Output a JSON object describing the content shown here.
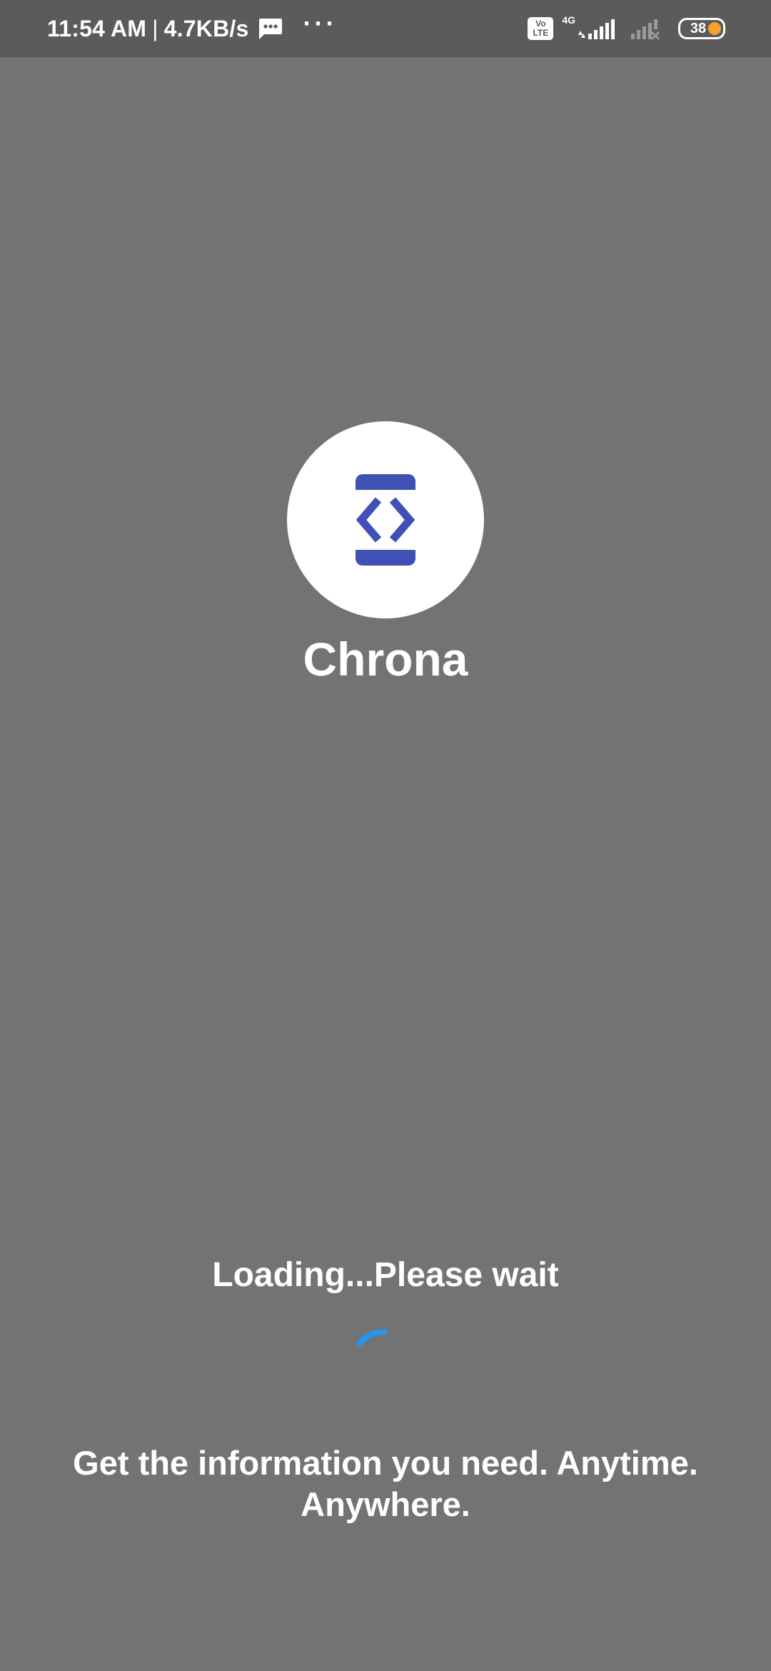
{
  "status_bar": {
    "time": "11:54 AM",
    "separator": "|",
    "net_speed": "4.7KB/s",
    "more_indicator": "···",
    "volte_label_top": "Vo",
    "volte_label_bottom": "LTE",
    "network_type": "4G",
    "battery_level": "38",
    "icons": [
      "message-icon",
      "volte-icon",
      "signal-icon",
      "signal-no-service-icon",
      "battery-icon"
    ]
  },
  "splash": {
    "app_name": "Chrona",
    "logo_icon": "developer-mode-icon",
    "logo_color": "#3f51b5",
    "loading_text": "Loading...Please wait",
    "spinner_color": "#2196f3",
    "tagline": "Get the information you need. Anytime. Anywhere."
  },
  "colors": {
    "background": "#737373",
    "status_bar": "#5b5b5b",
    "battery_fill": "#f3a12f"
  }
}
